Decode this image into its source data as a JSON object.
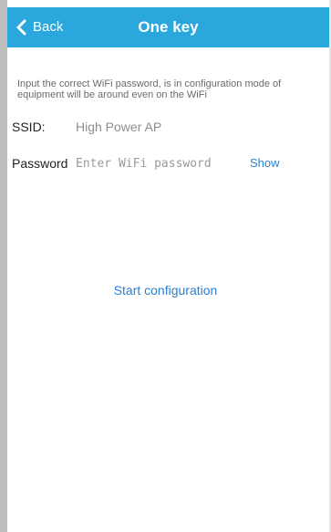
{
  "header": {
    "back_label": "Back",
    "title": "One key",
    "back_icon": "chevron-left-icon",
    "background_color": "#2aa8de"
  },
  "hint_text": "Input the correct WiFi password, is in configuration mode of equipment will be around even on the WiFi",
  "ssid": {
    "label": "SSID:",
    "value": "High Power AP"
  },
  "password": {
    "label": "Password",
    "placeholder": "Enter WiFi password",
    "value": "",
    "show_label": "Show"
  },
  "start_label": "Start configuration",
  "accent_color": "#2b7fd0"
}
